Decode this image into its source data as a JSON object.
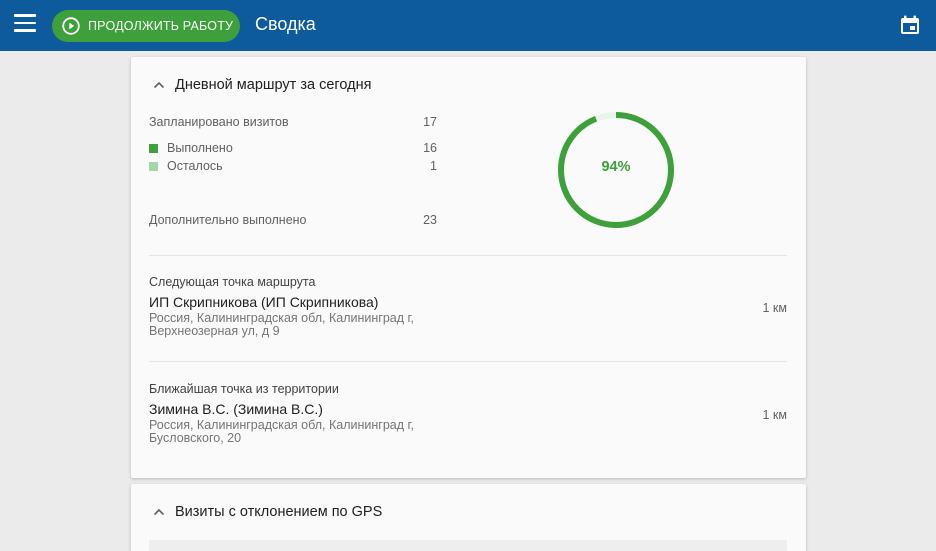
{
  "appbar": {
    "continue_label": "ПРОДОЛЖИТЬ РАБОТУ",
    "title": "Сводка",
    "colors": {
      "bar": "#0d5b9c",
      "button": "#3da03a"
    }
  },
  "route_card": {
    "title": "Дневной маршрут за сегодня",
    "planned_label": "Запланировано визитов",
    "planned_value": "17",
    "done_label": "Выполнено",
    "done_value": "16",
    "left_label": "Осталось",
    "left_value": "1",
    "extra_label": "Дополнительно выполнено",
    "extra_value": "23",
    "progress_percent_text": "94%",
    "progress_fraction": 0.94,
    "colors": {
      "done": "#3da03a",
      "left": "#a5d6a7"
    },
    "next_point": {
      "caption": "Следующая точка маршрута",
      "name": "ИП Скрипникова (ИП Скрипникова)",
      "address": "Россия, Калининградская обл, Калининград г, Верхнеозерная ул, д 9",
      "distance": "1 км"
    },
    "nearest_point": {
      "caption": "Ближайшая точка из территории",
      "name": "Зимина В.С. (Зимина В.С.)",
      "address": "Россия, Калининградская обл, Калининград г, Бусловского, 20",
      "distance": "1 км"
    }
  },
  "gps_card": {
    "title": "Визиты с отклонением по GPS"
  }
}
